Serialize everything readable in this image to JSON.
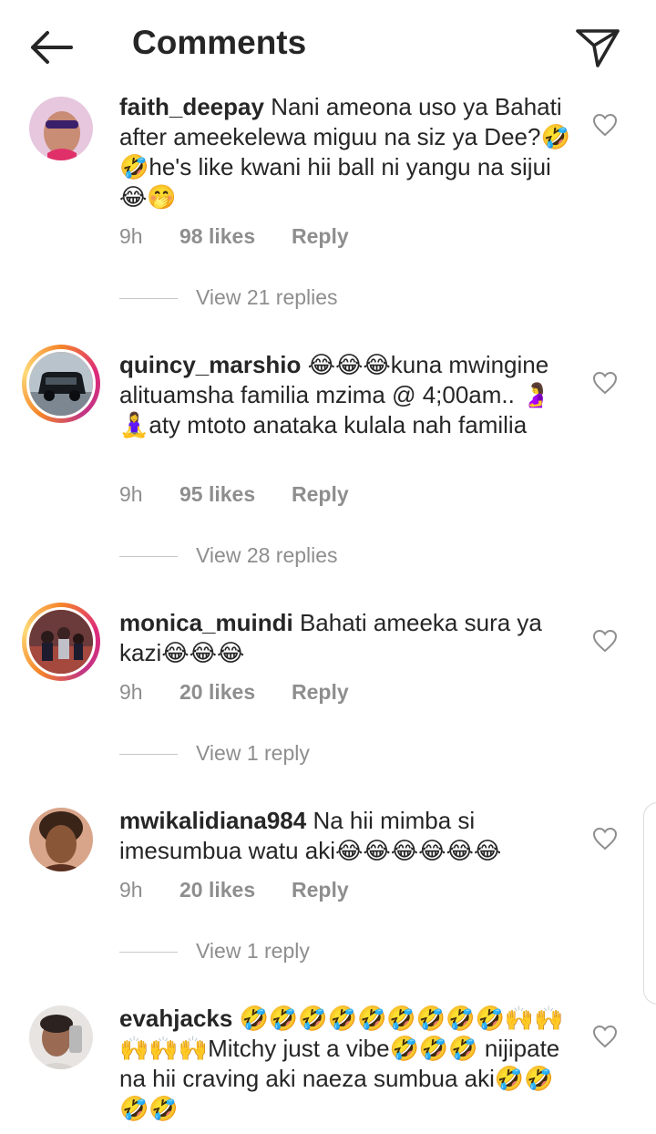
{
  "header": {
    "title": "Comments",
    "back_icon": "arrow-left-icon",
    "share_icon": "send-icon"
  },
  "comments": [
    {
      "username": "faith_deepay",
      "text": "Nani ameona uso ya Bahati after ameekelewa miguu na siz ya Dee?🤣🤣he's like kwani hii ball ni yangu na sijui😂🤭",
      "time": "9h",
      "likes": "98 likes",
      "reply": "Reply",
      "view_replies": "View 21 replies",
      "has_story_ring": false
    },
    {
      "username": "quincy_marshio",
      "text": "😂😂😂kuna mwingine alituamsha familia mzima @ 4;00am.. 🤰🧘‍♀️aty mtoto anataka kulala nah familia",
      "time": "9h",
      "likes": "95 likes",
      "reply": "Reply",
      "view_replies": "View 28 replies",
      "has_story_ring": true
    },
    {
      "username": "monica_muindi",
      "text": "Bahati ameeka sura ya kazi😂😂😂",
      "time": "9h",
      "likes": "20 likes",
      "reply": "Reply",
      "view_replies": "View 1 reply",
      "has_story_ring": true
    },
    {
      "username": "mwikalidiana984",
      "text": "Na hii mimba si imesumbua watu aki😂😂😂😂😂😂",
      "time": "9h",
      "likes": "20 likes",
      "reply": "Reply",
      "view_replies": "View 1 reply",
      "has_story_ring": false
    },
    {
      "username": "evahjacks",
      "text": "🤣🤣🤣🤣🤣🤣🤣🤣🤣🙌🙌🙌🙌🙌Mitchy just a vibe🤣🤣🤣 nijipate na hii craving aki naeza sumbua aki🤣🤣🤣🤣",
      "has_story_ring": false
    }
  ],
  "colors": {
    "text": "#262626",
    "secondary": "#8e8e8e",
    "divider": "#c7c7c7"
  }
}
